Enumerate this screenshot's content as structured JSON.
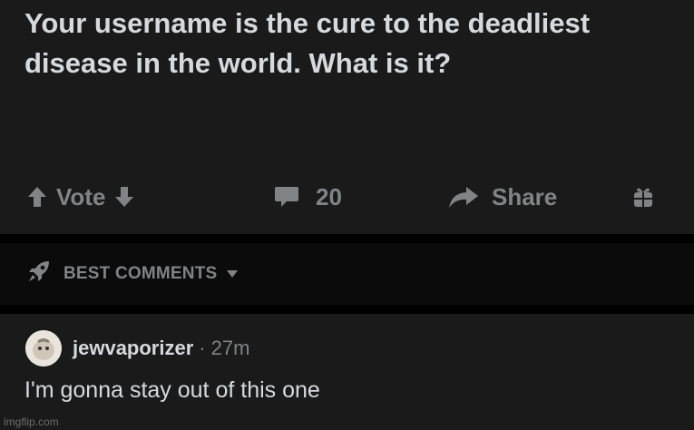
{
  "post": {
    "title": "Your username is the cure to the deadliest disease in the world. What is it?"
  },
  "actions": {
    "vote_label": "Vote",
    "comment_count": "20",
    "share_label": "Share"
  },
  "sort": {
    "label": "BEST COMMENTS"
  },
  "comment": {
    "username": "jewvaporizer",
    "separator": "·",
    "timestamp": "27m",
    "body": "I'm gonna stay out of this one"
  },
  "watermark": "imgflip.com",
  "icons": {
    "upvote": "upvote-arrow-icon",
    "downvote": "downvote-arrow-icon",
    "comments": "speech-bubble-icon",
    "share": "share-arrow-icon",
    "award": "gift-award-icon",
    "sort": "rocket-icon",
    "chevron": "chevron-down-icon"
  },
  "colors": {
    "background": "#000000",
    "card": "#1a1a1b",
    "text_primary": "#d7dadc",
    "text_muted": "#818384"
  }
}
